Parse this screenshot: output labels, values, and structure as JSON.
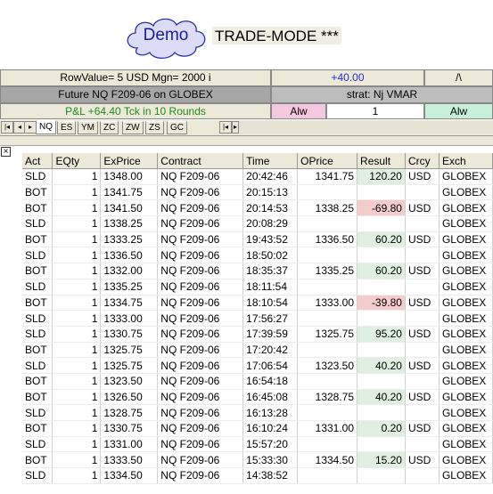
{
  "header": {
    "demo_label": "Demo",
    "mode_label": "TRADE-MODE ***"
  },
  "info": {
    "row_value": "RowValue= 5 USD Mgn= 2000 i",
    "pnl_value": "+40.00",
    "caret": "/\\",
    "contract": "Future NQ  F209-06 on GLOBEX",
    "strategy": "strat: Nj VMAR",
    "pnl_summary": "P&L +64.40 Tck in 10 Rounds",
    "alw_left": "Alw",
    "qty": "1",
    "alw_right": "Alw"
  },
  "tabs": {
    "nav_first": "|◂",
    "nav_prev": "◂",
    "nav_next": "▸",
    "nav_last": "▸|",
    "items": [
      "NQ",
      "ES",
      "YM",
      "ZC",
      "ZW",
      "ZS",
      "GC"
    ],
    "active": "NQ",
    "scroll_left": "|◂",
    "scroll_right": "▸"
  },
  "grid": {
    "close": "×",
    "columns": [
      "Act",
      "EQty",
      "ExPrice",
      "Contract",
      "Time",
      "OPrice",
      "Result",
      "Crcy",
      "Exch"
    ],
    "rows": [
      {
        "act": "SLD",
        "eqty": "1",
        "exprice": "1348.00",
        "contract": "NQ  F209-06",
        "time": "20:42:46",
        "oprice": "1341.75",
        "result": "120.20",
        "crcy": "USD",
        "exch": "GLOBEX"
      },
      {
        "act": "BOT",
        "eqty": "1",
        "exprice": "1341.75",
        "contract": "NQ  F209-06",
        "time": "20:15:13",
        "oprice": "",
        "result": "",
        "crcy": "",
        "exch": "GLOBEX"
      },
      {
        "act": "BOT",
        "eqty": "1",
        "exprice": "1341.50",
        "contract": "NQ  F209-06",
        "time": "20:14:53",
        "oprice": "1338.25",
        "result": "-69.80",
        "crcy": "USD",
        "exch": "GLOBEX"
      },
      {
        "act": "SLD",
        "eqty": "1",
        "exprice": "1338.25",
        "contract": "NQ  F209-06",
        "time": "20:08:29",
        "oprice": "",
        "result": "",
        "crcy": "",
        "exch": "GLOBEX"
      },
      {
        "act": "BOT",
        "eqty": "1",
        "exprice": "1333.25",
        "contract": "NQ  F209-06",
        "time": "19:43:52",
        "oprice": "1336.50",
        "result": "60.20",
        "crcy": "USD",
        "exch": "GLOBEX"
      },
      {
        "act": "SLD",
        "eqty": "1",
        "exprice": "1336.50",
        "contract": "NQ  F209-06",
        "time": "18:50:02",
        "oprice": "",
        "result": "",
        "crcy": "",
        "exch": "GLOBEX"
      },
      {
        "act": "BOT",
        "eqty": "1",
        "exprice": "1332.00",
        "contract": "NQ  F209-06",
        "time": "18:35:37",
        "oprice": "1335.25",
        "result": "60.20",
        "crcy": "USD",
        "exch": "GLOBEX"
      },
      {
        "act": "SLD",
        "eqty": "1",
        "exprice": "1335.25",
        "contract": "NQ  F209-06",
        "time": "18:11:54",
        "oprice": "",
        "result": "",
        "crcy": "",
        "exch": "GLOBEX"
      },
      {
        "act": "BOT",
        "eqty": "1",
        "exprice": "1334.75",
        "contract": "NQ  F209-06",
        "time": "18:10:54",
        "oprice": "1333.00",
        "result": "-39.80",
        "crcy": "USD",
        "exch": "GLOBEX"
      },
      {
        "act": "SLD",
        "eqty": "1",
        "exprice": "1333.00",
        "contract": "NQ  F209-06",
        "time": "17:56:27",
        "oprice": "",
        "result": "",
        "crcy": "",
        "exch": "GLOBEX"
      },
      {
        "act": "SLD",
        "eqty": "1",
        "exprice": "1330.75",
        "contract": "NQ  F209-06",
        "time": "17:39:59",
        "oprice": "1325.75",
        "result": "95.20",
        "crcy": "USD",
        "exch": "GLOBEX"
      },
      {
        "act": "BOT",
        "eqty": "1",
        "exprice": "1325.75",
        "contract": "NQ  F209-06",
        "time": "17:20:42",
        "oprice": "",
        "result": "",
        "crcy": "",
        "exch": "GLOBEX"
      },
      {
        "act": "SLD",
        "eqty": "1",
        "exprice": "1325.75",
        "contract": "NQ  F209-06",
        "time": "17:06:54",
        "oprice": "1323.50",
        "result": "40.20",
        "crcy": "USD",
        "exch": "GLOBEX"
      },
      {
        "act": "BOT",
        "eqty": "1",
        "exprice": "1323.50",
        "contract": "NQ  F209-06",
        "time": "16:54:18",
        "oprice": "",
        "result": "",
        "crcy": "",
        "exch": "GLOBEX"
      },
      {
        "act": "BOT",
        "eqty": "1",
        "exprice": "1326.50",
        "contract": "NQ  F209-06",
        "time": "16:45:08",
        "oprice": "1328.75",
        "result": "40.20",
        "crcy": "USD",
        "exch": "GLOBEX"
      },
      {
        "act": "SLD",
        "eqty": "1",
        "exprice": "1328.75",
        "contract": "NQ  F209-06",
        "time": "16:13:28",
        "oprice": "",
        "result": "",
        "crcy": "",
        "exch": "GLOBEX"
      },
      {
        "act": "BOT",
        "eqty": "1",
        "exprice": "1330.75",
        "contract": "NQ  F209-06",
        "time": "16:10:24",
        "oprice": "1331.00",
        "result": "0.20",
        "crcy": "USD",
        "exch": "GLOBEX"
      },
      {
        "act": "SLD",
        "eqty": "1",
        "exprice": "1331.00",
        "contract": "NQ  F209-06",
        "time": "15:57:20",
        "oprice": "",
        "result": "",
        "crcy": "",
        "exch": "GLOBEX"
      },
      {
        "act": "BOT",
        "eqty": "1",
        "exprice": "1333.50",
        "contract": "NQ  F209-06",
        "time": "15:33:30",
        "oprice": "1334.50",
        "result": "15.20",
        "crcy": "USD",
        "exch": "GLOBEX"
      },
      {
        "act": "SLD",
        "eqty": "1",
        "exprice": "1334.50",
        "contract": "NQ  F209-06",
        "time": "14:38:52",
        "oprice": "",
        "result": "",
        "crcy": "",
        "exch": "GLOBEX"
      }
    ]
  },
  "colors": {
    "demo_text": "#1b1f8a",
    "cloud_fill": "#dcdcf7",
    "positive_result": "#dff0e0",
    "negative_result": "#f5cccc",
    "pnl_text": "#1f8b1f",
    "link_blue": "#1f2fd6"
  }
}
